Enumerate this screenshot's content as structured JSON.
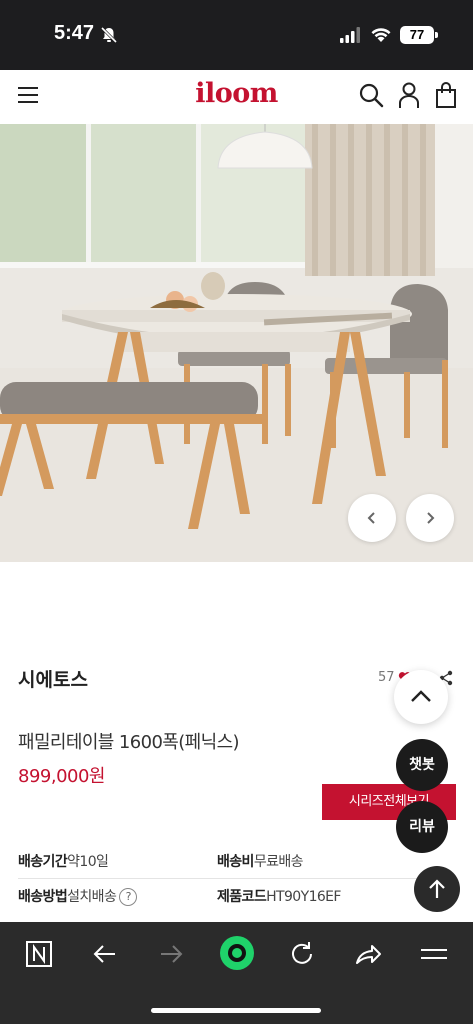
{
  "status_bar": {
    "time": "5:47",
    "battery": "77"
  },
  "header": {
    "logo": "iloom"
  },
  "product": {
    "series": "시에토스",
    "wish_count": "57",
    "name": "패밀리테이블 1600폭(페닉스)",
    "price": "899,000원",
    "series_button": "시리즈전체보기"
  },
  "info": {
    "shipping_period_label": "배송기간",
    "shipping_period_value": "약10일",
    "shipping_fee_label": "배송비",
    "shipping_fee_value": "무료배송",
    "shipping_method_label": "배송방법",
    "shipping_method_value": "설치배송",
    "product_code_label": "제품코드",
    "product_code_value": "HT90Y16EF",
    "help": "?"
  },
  "floating": {
    "chatbot": "챗봇",
    "review": "리뷰"
  },
  "colors": {
    "brand": "#c41230",
    "toolbar": "#2b2b2b",
    "toolbar_accent": "#1fd26a"
  },
  "icons": [
    "menu-icon",
    "search-icon",
    "user-icon",
    "shopping-bag-icon",
    "chevron-left-icon",
    "chevron-right-icon",
    "heart-icon",
    "share-icon",
    "chevron-up-icon",
    "arrow-up-icon",
    "naver-n-icon",
    "back-arrow-icon",
    "forward-arrow-icon",
    "naver-green-dot-icon",
    "reload-icon",
    "share-arrow-icon",
    "hamburger-menu-icon"
  ]
}
